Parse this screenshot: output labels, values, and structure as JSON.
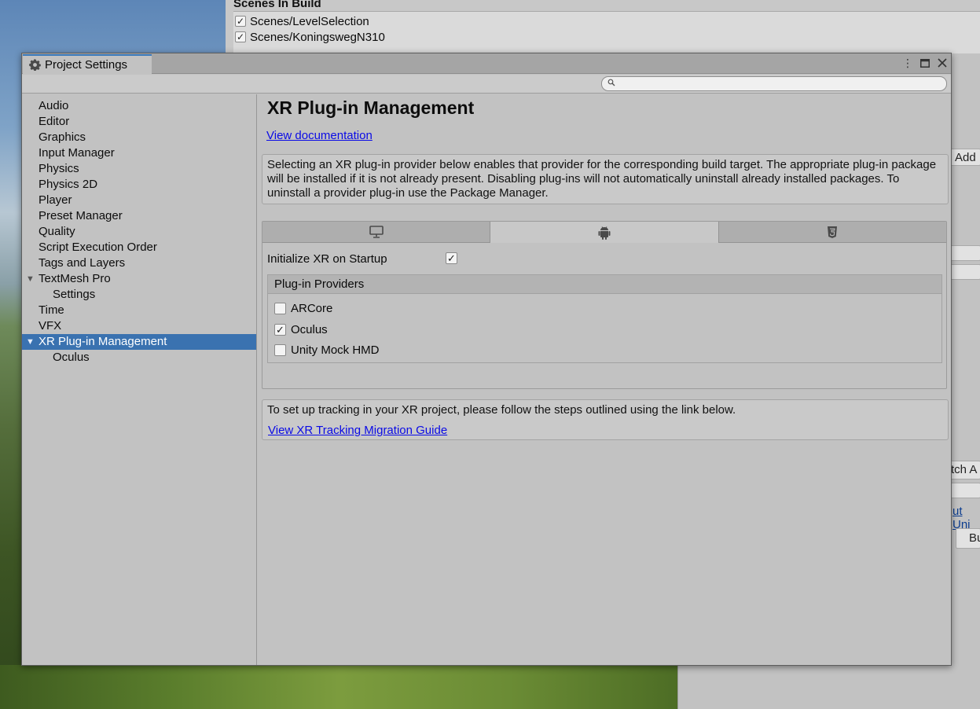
{
  "background": {
    "build_header": "Scenes In Build",
    "scenes": [
      {
        "label": "Scenes/LevelSelection",
        "checked": true
      },
      {
        "label": "Scenes/KoningswegN310",
        "checked": true
      }
    ],
    "fragments": {
      "add": "Add",
      "patch": "tch A",
      "unity_link": "ut Uni",
      "build": "Bu"
    }
  },
  "window": {
    "tab_title": "Project Settings",
    "tab_icon": "gear-icon",
    "controls": [
      "more-options-icon",
      "maximize-icon",
      "close-icon"
    ],
    "search": {
      "value": "",
      "placeholder": ""
    }
  },
  "sidebar": {
    "items": [
      {
        "label": "Audio",
        "level": 0
      },
      {
        "label": "Editor",
        "level": 0
      },
      {
        "label": "Graphics",
        "level": 0
      },
      {
        "label": "Input Manager",
        "level": 0
      },
      {
        "label": "Physics",
        "level": 0
      },
      {
        "label": "Physics 2D",
        "level": 0
      },
      {
        "label": "Player",
        "level": 0
      },
      {
        "label": "Preset Manager",
        "level": 0
      },
      {
        "label": "Quality",
        "level": 0
      },
      {
        "label": "Script Execution Order",
        "level": 0
      },
      {
        "label": "Tags and Layers",
        "level": 0
      },
      {
        "label": "TextMesh Pro",
        "level": 0,
        "expanded": true
      },
      {
        "label": "Settings",
        "level": 1
      },
      {
        "label": "Time",
        "level": 0
      },
      {
        "label": "VFX",
        "level": 0
      },
      {
        "label": "XR Plug-in Management",
        "level": 0,
        "expanded": true,
        "selected": true
      },
      {
        "label": "Oculus",
        "level": 1
      }
    ]
  },
  "main": {
    "title": "XR Plug-in Management",
    "doc_link": "View documentation",
    "help_text": "Selecting an XR plug-in provider below enables that provider for the corresponding build target. The appropriate plug-in package will be installed if it is not already present. Disabling plug-ins will not automatically uninstall already installed packages. To uninstall a provider plug-in use the Package Manager.",
    "platform_tabs": [
      {
        "icon": "desktop-icon",
        "active": false
      },
      {
        "icon": "android-icon",
        "active": true
      },
      {
        "icon": "html5-icon",
        "active": false
      }
    ],
    "init_label": "Initialize XR on Startup",
    "init_checked": true,
    "providers_header": "Plug-in Providers",
    "providers": [
      {
        "label": "ARCore",
        "checked": false
      },
      {
        "label": "Oculus",
        "checked": true
      },
      {
        "label": "Unity Mock HMD",
        "checked": false
      }
    ],
    "tracking_text": "To set up tracking in your XR project, please follow the steps outlined using the link below.",
    "tracking_link": "View XR Tracking Migration Guide "
  },
  "colors": {
    "selection": "#3a72b0",
    "link": "#0a0ae6",
    "tab_accent": "#3a79bb"
  }
}
